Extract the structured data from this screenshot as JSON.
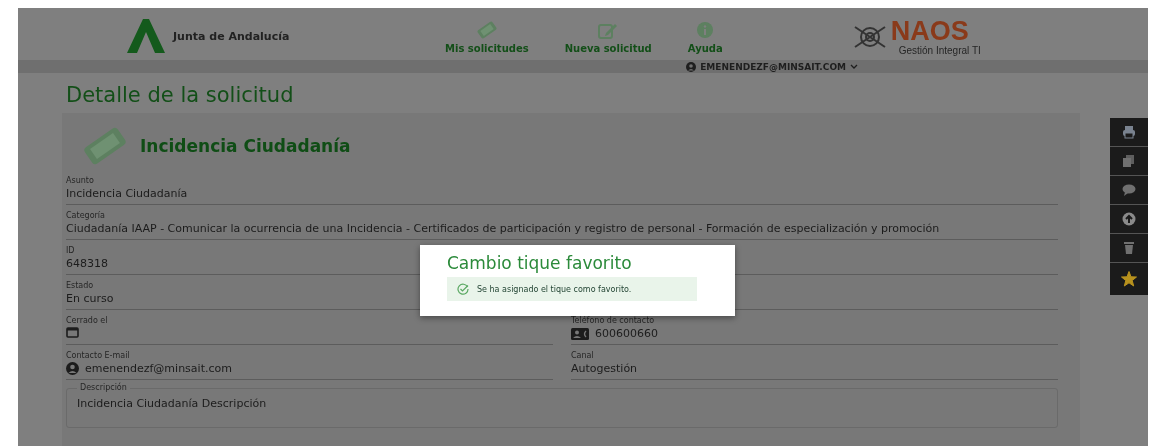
{
  "header": {
    "brand": "Junta de Andalucía",
    "nav": [
      {
        "label": "Mis solicitudes"
      },
      {
        "label": "Nueva solicitud"
      },
      {
        "label": "Ayuda"
      }
    ],
    "product": {
      "name": "NAOS",
      "tagline": "Gestión Integral TI"
    },
    "user": "EMENENDEZF@MINSAIT.COM"
  },
  "page_title": "Detalle de la solicitud",
  "card": {
    "title": "Incidencia Ciudadanía",
    "field_rows": [
      [
        {
          "label": "Asunto",
          "value": "Incidencia Ciudadanía",
          "kind": "text"
        }
      ],
      [
        {
          "label": "Categoría",
          "value": "Ciudadanía IAAP - Comunicar la ocurrencia de una Incidencia - Certificados de participación y registro de personal - Formación de especialización y promoción",
          "kind": "text"
        }
      ],
      [
        {
          "label": "ID",
          "value": "648318",
          "kind": "text"
        }
      ],
      [
        {
          "label": "Estado",
          "value": "En curso",
          "kind": "text"
        }
      ],
      [
        {
          "label": "Cerrado el",
          "kind": "date"
        },
        {
          "label": "Teléfono de contacto",
          "value": "600600660",
          "kind": "phone"
        }
      ],
      [
        {
          "label": "Contacto E-mail",
          "value": "emenendezf@minsait.com",
          "kind": "email"
        },
        {
          "label": "Canal",
          "value": "Autogestión",
          "kind": "text"
        }
      ]
    ],
    "description": {
      "label": "Descripción",
      "value": "Incidencia Ciudadanía Descripción"
    }
  },
  "actions": [
    {
      "kind": "print"
    },
    {
      "kind": "copy"
    },
    {
      "kind": "comment"
    },
    {
      "kind": "upload"
    },
    {
      "kind": "delete"
    },
    {
      "kind": "favorite",
      "on": true
    }
  ],
  "dialog": {
    "title": "Cambio tique favorito",
    "message": "Se ha asignado el tique como favorito."
  }
}
